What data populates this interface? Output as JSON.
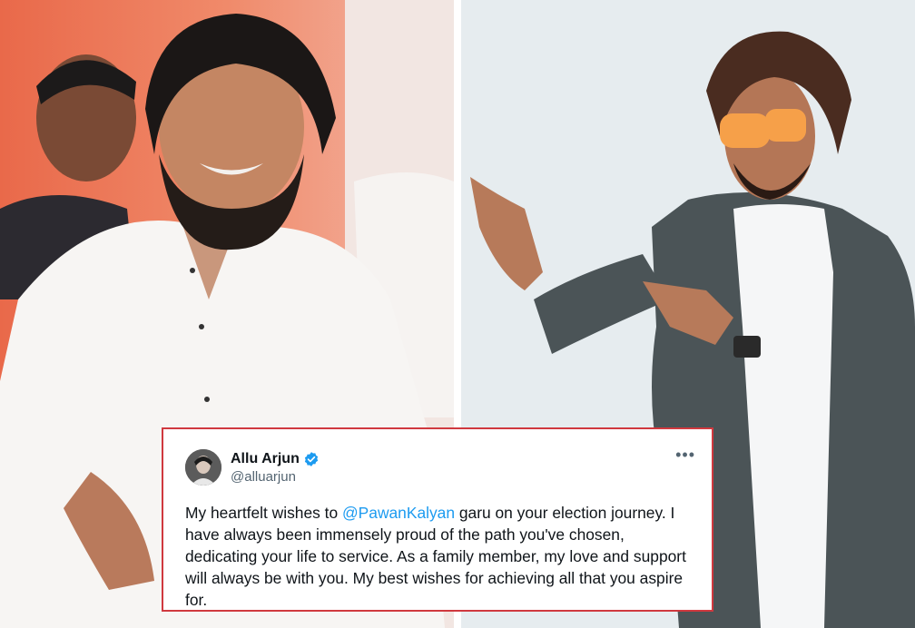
{
  "tweet": {
    "display_name": "Allu Arjun",
    "handle": "@alluarjun",
    "text_before": "My heartfelt wishes to ",
    "mention": "@PawanKalyan",
    "text_after": " garu on your election journey. I have always been immensely proud of the path you've chosen, dedicating your life to service. As a family member, my love and support will always be with you. My best wishes for achieving all that you aspire for.",
    "more_glyph": "•••"
  },
  "icons": {
    "verified": "verified-badge-icon",
    "more": "more-options-icon"
  },
  "colors": {
    "card_border": "#d0393f",
    "mention": "#1d9bf0",
    "verified": "#1d9bf0",
    "text": "#0f1419",
    "muted": "#536471"
  }
}
